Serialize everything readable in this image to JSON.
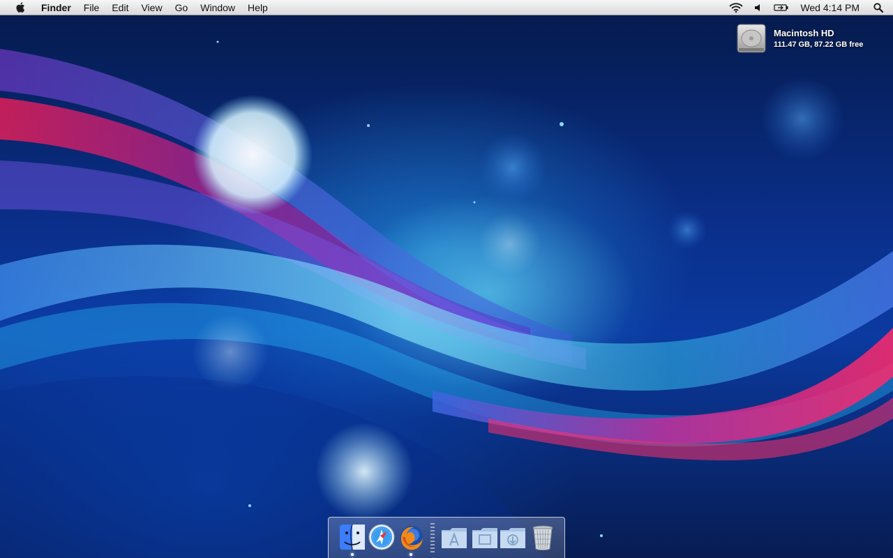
{
  "menubar": {
    "apple_icon": "apple-logo-icon",
    "app_name": "Finder",
    "menus": [
      "File",
      "Edit",
      "View",
      "Go",
      "Window",
      "Help"
    ],
    "status_icons": [
      "wifi-icon",
      "volume-icon",
      "battery-icon"
    ],
    "clock": "Wed 4:14 PM",
    "search_icon": "spotlight-search-icon"
  },
  "desktop": {
    "disk": {
      "name": "Macintosh HD",
      "info": "111.47 GB, 87.22 GB free",
      "icon": "hard-drive-icon"
    }
  },
  "dock": {
    "apps": [
      {
        "name": "Finder",
        "icon": "finder-icon",
        "running": true
      },
      {
        "name": "Safari",
        "icon": "safari-icon",
        "running": false
      },
      {
        "name": "Firefox",
        "icon": "firefox-icon",
        "running": true
      }
    ],
    "stacks": [
      {
        "name": "Applications",
        "icon": "applications-folder-icon"
      },
      {
        "name": "Documents",
        "icon": "documents-folder-icon"
      },
      {
        "name": "Downloads",
        "icon": "downloads-folder-icon"
      }
    ],
    "trash": {
      "name": "Trash",
      "icon": "trash-icon"
    }
  },
  "colors": {
    "wallpaper_dark": "#051a4a",
    "wallpaper_blue": "#0b3aa0",
    "wave_cyan": "#6fe3ff",
    "wave_magenta": "#d0206a",
    "wave_purple": "#7a3fd0"
  }
}
